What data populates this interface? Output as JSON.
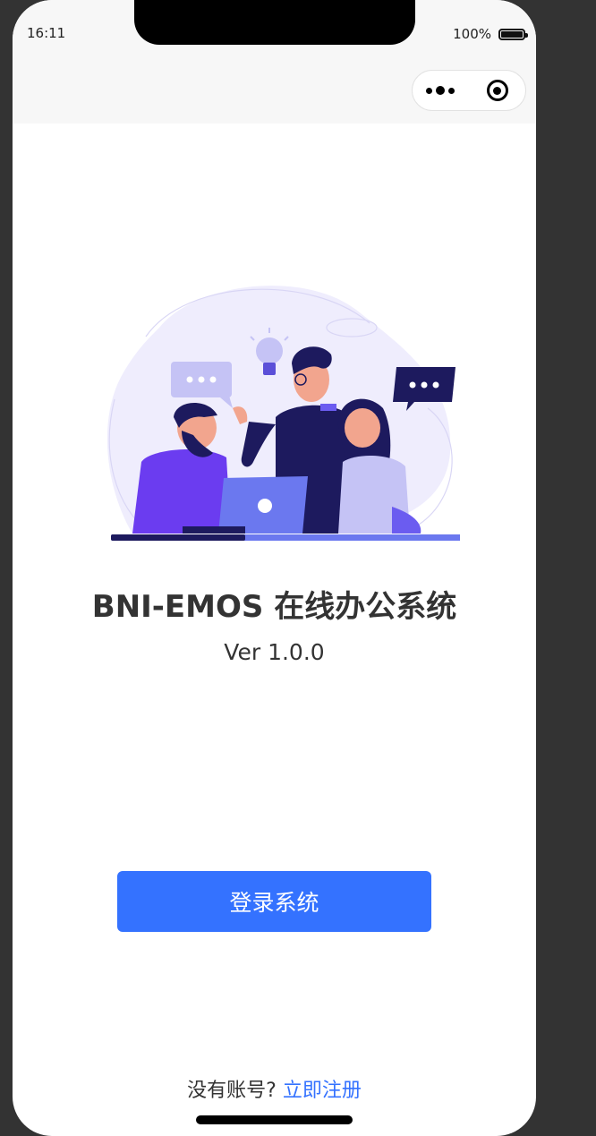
{
  "status_bar": {
    "time": "16:11",
    "battery_percent": "100%",
    "battery_level": 1.0
  },
  "nav_bar": {
    "capsule_more_icon": "more-dots-icon",
    "capsule_close_icon": "target-close-icon"
  },
  "main": {
    "title": "BNI-EMOS 在线办公系统",
    "version": "Ver 1.0.0",
    "login_button": "登录系统"
  },
  "footer": {
    "prompt": "没有账号?",
    "register_link": "立即注册"
  },
  "colors": {
    "accent": "#3472ff",
    "illustration_bg": "#efedfd",
    "illustration_dark": "#1d1a5e",
    "illustration_purple": "#6b5cf0"
  }
}
